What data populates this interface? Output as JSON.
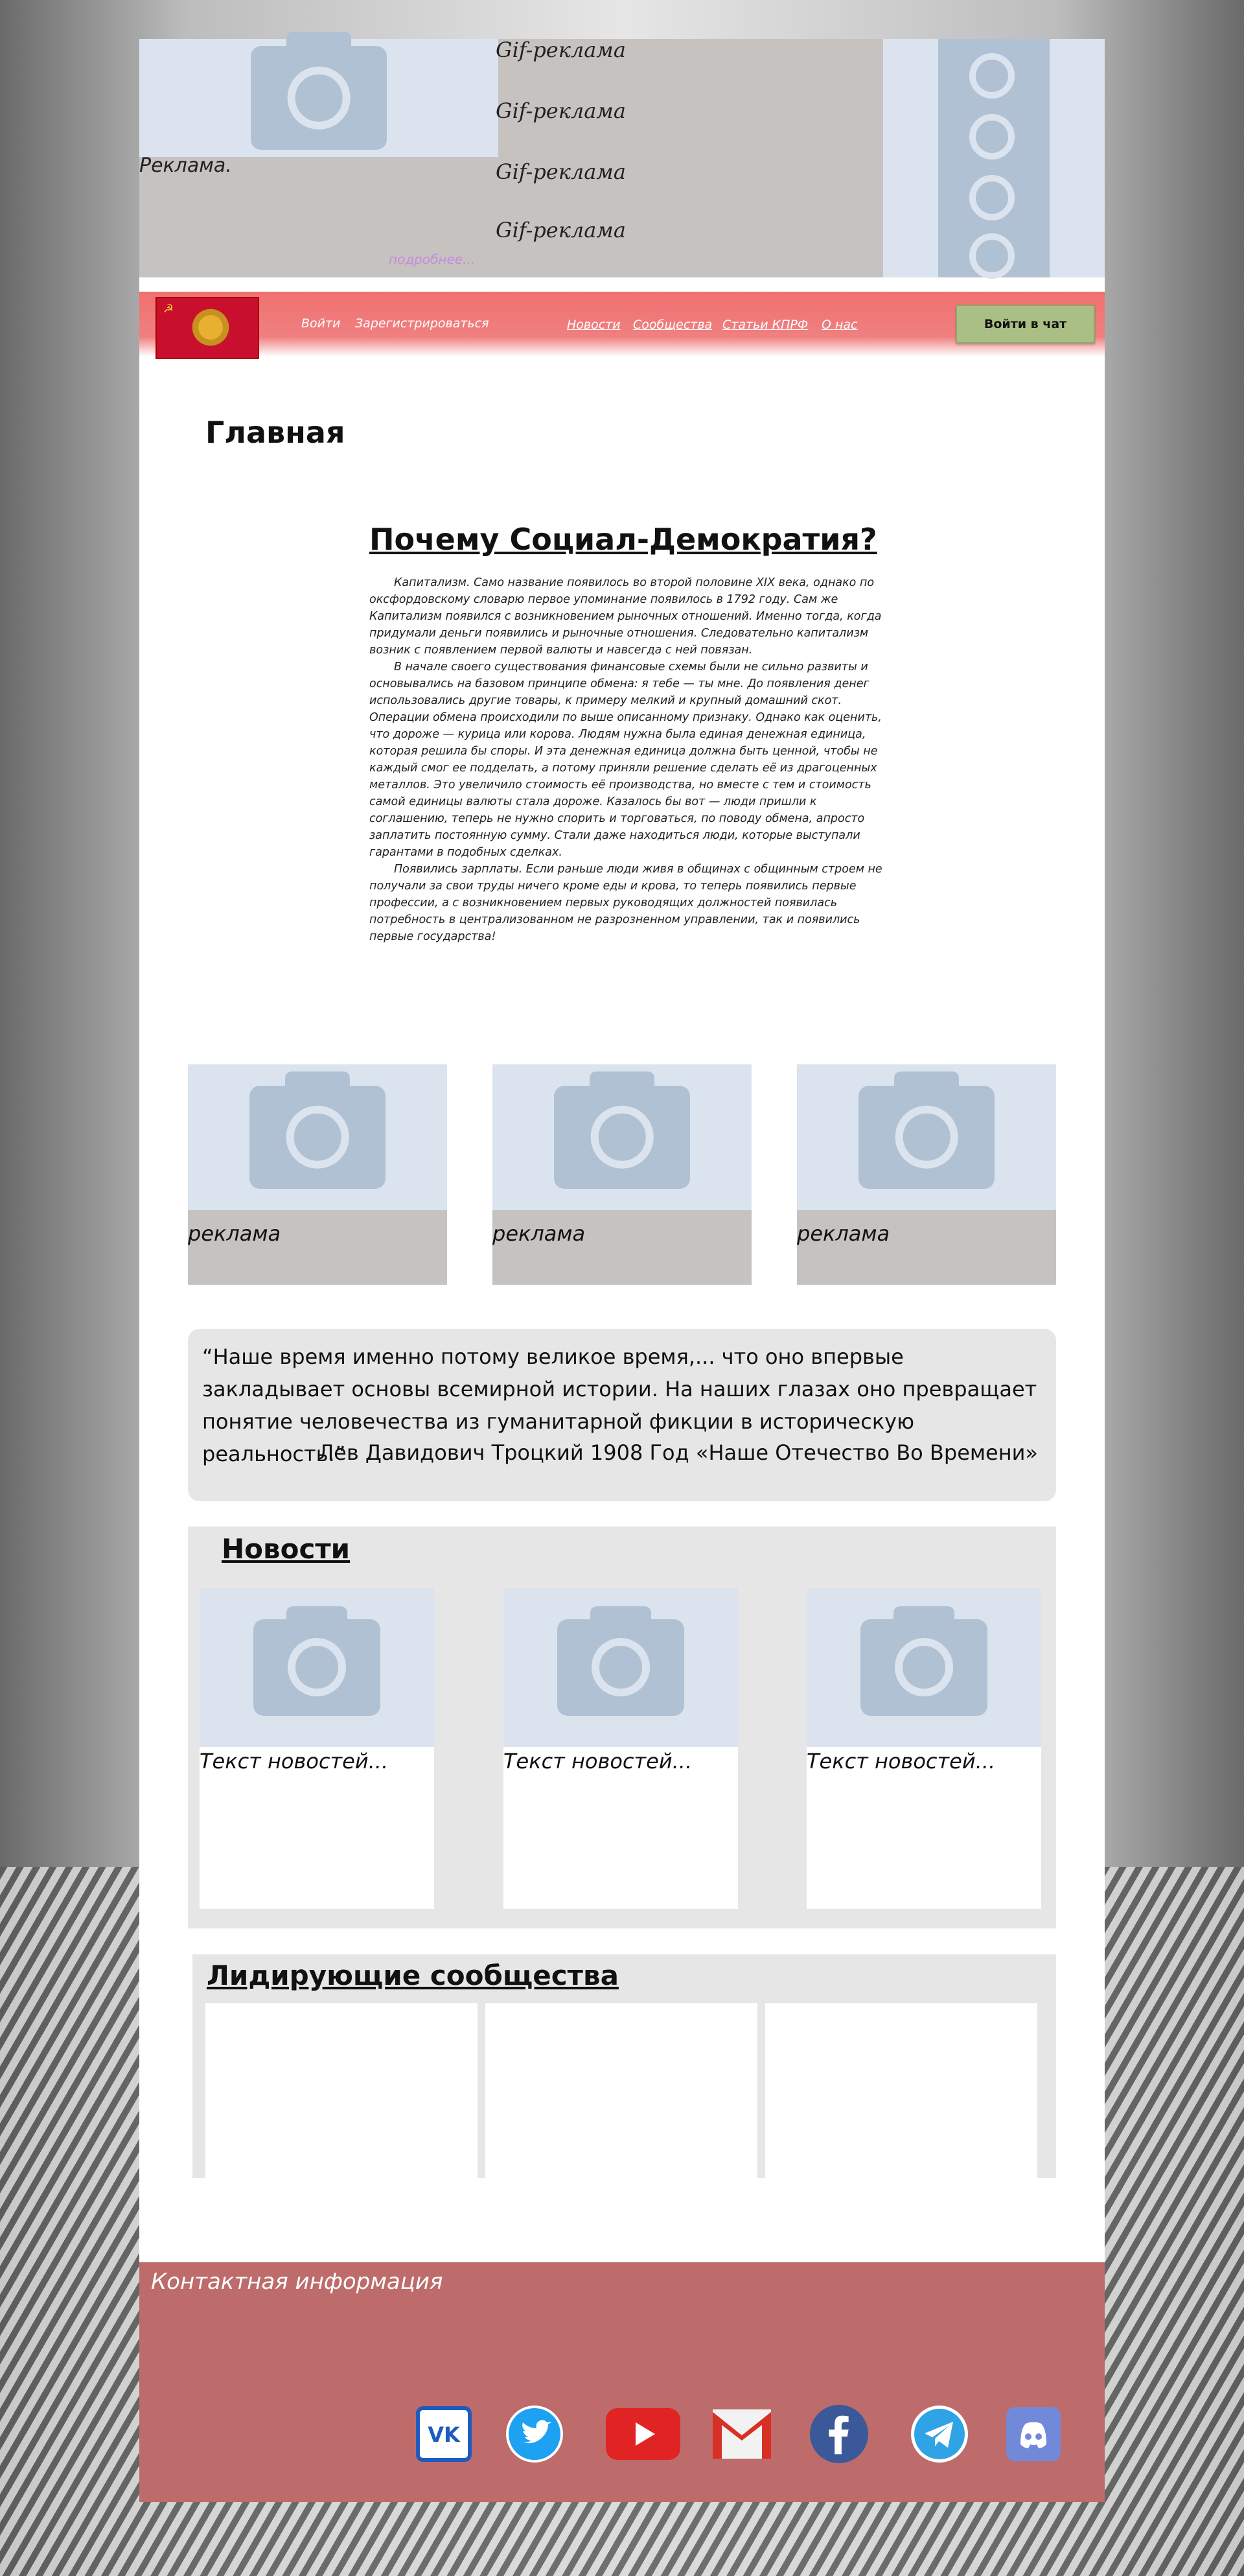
{
  "top_ad": {
    "gif_ads": [
      "Gif-реклама",
      "Gif-реклама",
      "Gif-реклама",
      "Gif-реклама"
    ],
    "label": "Реклама.",
    "more_link": "подробнее..."
  },
  "header": {
    "login": "Войти",
    "register": "Зарегистрироваться",
    "nav": [
      "Новости",
      "Сообщества",
      "Статьи КПРФ",
      "О нас"
    ],
    "chat_button": "Войти в чат"
  },
  "main": {
    "page_title": "Главная",
    "article_title": "Почему Социал-Демократия?",
    "article_paragraphs": [
      "Капитализм. Само название появилось во второй половине XIX века, однако по оксфордовскому словарю первое упоминание появилось в 1792 году. Сам же Капитализм появился с возникновением рыночных отношений. Именно тогда, когда придумали деньги появились и рыночные отношения. Следовательно капитализм возник с появлением первой валюты и навсегда с ней повязан.",
      "В начале своего существования финансовые схемы были не сильно развиты и основывались на базовом принципе обмена: я тебе — ты мне. До появления денег использовались другие товары, к примеру мелкий и крупный домашний скот. Операции обмена происходили по выше описанному признаку. Однако как оценить, что дороже — курица или корова. Людям нужна была единая денежная единица, которая решила бы споры. И эта денежная единица должна быть ценной, чтобы не каждый смог ее подделать, а потому приняли решение сделать её из драгоценных металлов. Это увеличило стоимость её производства, но вместе с тем и стоимость самой единицы валюты стала дороже. Казалось бы вот — люди пришли к соглашению, теперь не нужно спорить и торговаться, по поводу обмена, апросто заплатить постоянную сумму. Стали даже находиться люди, которые выступали гарантами в подобных сделках.",
      "Появились зарплаты. Если раньше люди живя в общинах с общинным строем не получали за свои труды ничего кроме еды и крова, то теперь появились первые профессии, а с возникновением первых руководящих должностей появилась потребность в централизованном не разрозненном управлении, так и появились первые государства!"
    ]
  },
  "ads_row": [
    "реклама",
    "реклама",
    "реклама"
  ],
  "quote": {
    "text": "“Наше время именно потому великое время,... что оно впервые закладывает основы всемирной истории. На наших глазах оно превращает понятие человечества из гуманитарной фикции в историческую реальность.”",
    "author": "Лев Давидович Троцкий 1908 Год «Наше Отечество Во Времени»"
  },
  "news": {
    "title": "Новости",
    "items": [
      "Текст новостей...",
      "Текст новостей...",
      "Текст новостей..."
    ]
  },
  "communities": {
    "title": "Лидирующие сообщества"
  },
  "footer": {
    "title": "Контактная информация",
    "social_icons": [
      "vk-icon",
      "twitter-icon",
      "youtube-icon",
      "gmail-icon",
      "facebook-icon",
      "telegram-icon",
      "discord-icon"
    ]
  },
  "colors": {
    "header": "#f07070",
    "footer": "#bd6b6b",
    "chat_button": "#a9bf83",
    "ad_background": "#c6c2c0",
    "panel": "#e6e6e6"
  }
}
